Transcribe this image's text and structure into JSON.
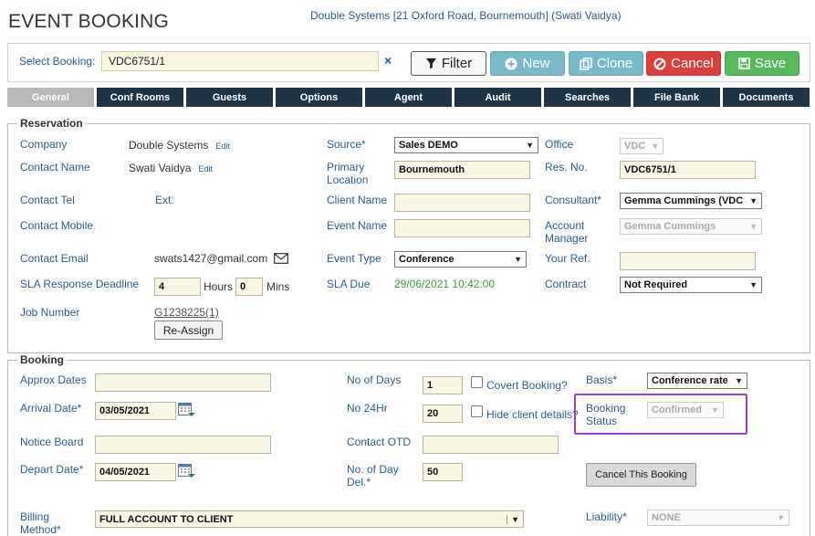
{
  "header": {
    "title": "EVENT BOOKING",
    "subtitle": "Double Systems [21 Oxford Road, Bournemouth] (Swati Vaidya)"
  },
  "select_bar": {
    "label": "Select Booking:",
    "value": "VDC6751/1",
    "clear": "×",
    "buttons": {
      "filter": "Filter",
      "new": "New",
      "clone": "Clone",
      "cancel": "Cancel",
      "save": "Save"
    }
  },
  "tabs": [
    "General",
    "Conf Rooms",
    "Guests",
    "Options",
    "Agent",
    "Audit",
    "Searches",
    "File Bank",
    "Documents"
  ],
  "reservation": {
    "legend": "Reservation",
    "company_label": "Company",
    "company_value": "Double Systems",
    "edit": "Edit",
    "contact_name_label": "Contact Name",
    "contact_name_value": "Swati Vaidya",
    "contact_tel_label": "Contact Tel",
    "ext_label": "Ext:",
    "contact_mobile_label": "Contact Mobile",
    "contact_email_label": "Contact Email",
    "contact_email_value": "swats1427@gmail.com",
    "sla_label": "SLA Response Deadline",
    "sla_hours": "4",
    "hours_label": "Hours",
    "sla_mins": "0",
    "mins_label": "Mins",
    "job_number_label": "Job Number",
    "job_number_value": "G1238225(1)",
    "reassign": "Re-Assign",
    "source_label": "Source*",
    "source_value": "Sales DEMO",
    "primary_location_label": "Primary Location",
    "primary_location_value": "Bournemouth",
    "client_name_label": "Client Name",
    "client_name_value": "",
    "event_name_label": "Event Name",
    "event_name_value": "",
    "event_type_label": "Event Type",
    "event_type_value": "Conference",
    "sla_due_label": "SLA Due",
    "sla_due_value": "29/06/2021 10:42:00",
    "office_label": "Office",
    "office_value": "VDC",
    "res_no_label": "Res. No.",
    "res_no_value": "VDC6751/1",
    "consultant_label": "Consultant*",
    "consultant_value": "Gemma Cummings (VDC",
    "account_manager_label": "Account Manager",
    "account_manager_value": "Gemma Cummings",
    "your_ref_label": "Your Ref.",
    "your_ref_value": "",
    "contract_label": "Contract",
    "contract_value": "Not Required"
  },
  "booking": {
    "legend": "Booking",
    "approx_dates_label": "Approx Dates",
    "approx_dates_value": "",
    "arrival_label": "Arrival Date*",
    "arrival_value": "03/05/2021",
    "notice_board_label": "Notice Board",
    "notice_board_value": "",
    "depart_label": "Depart Date*",
    "depart_value": "04/05/2021",
    "billing_label": "Billing Method*",
    "billing_value": "FULL ACCOUNT TO CLIENT",
    "no_days_label": "No of Days",
    "no_days_value": "1",
    "covert_label": "Covert Booking?",
    "no_24hr_label": "No 24Hr",
    "no_24hr_value": "20",
    "hide_client_label": "Hide client details?",
    "contact_otd_label": "Contact OTD",
    "contact_otd_value": "",
    "day_del_label": "No. of Day Del.*",
    "day_del_value": "50",
    "basis_label": "Basis*",
    "basis_value": "Conference rate",
    "booking_status_label": "Booking Status",
    "booking_status_value": "Confirmed",
    "cancel_booking": "Cancel This Booking",
    "liability_label": "Liability*",
    "liability_value": "NONE"
  },
  "colors": {
    "accent": "#2a5d8f",
    "tab_bg": "#1f3447",
    "highlight": "#9b3fd6",
    "cancel": "#d9403d",
    "save": "#58b85c",
    "info": "#7ab9c9"
  },
  "icons": [
    "filter-icon",
    "plus-circle-icon",
    "copy-icon",
    "ban-icon",
    "save-icon",
    "envelope-icon",
    "calendar-icon",
    "clear-icon"
  ]
}
